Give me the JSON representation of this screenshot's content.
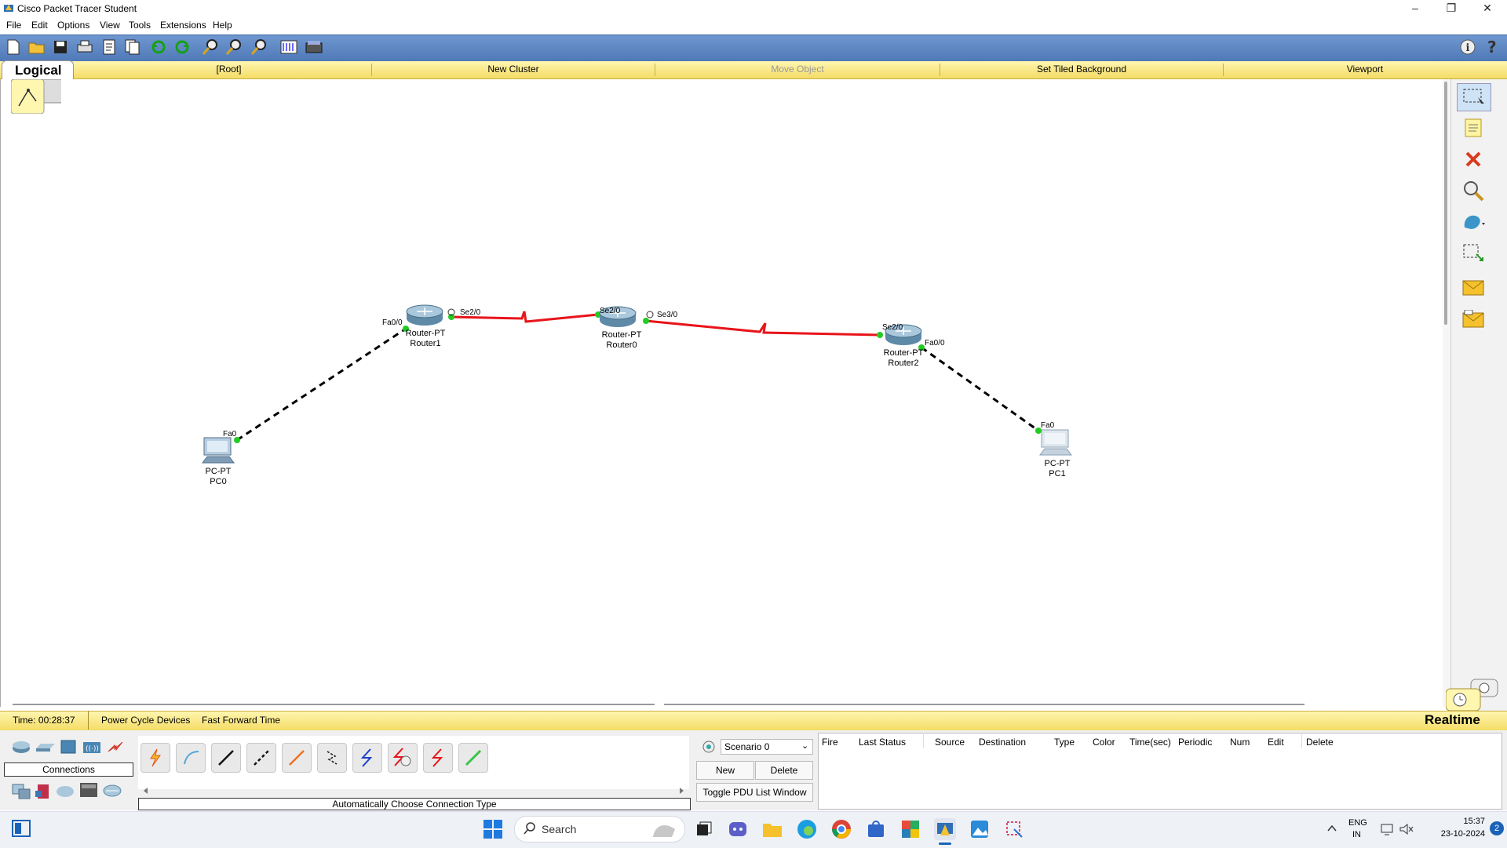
{
  "window": {
    "title": "Cisco Packet Tracer Student",
    "min": "–",
    "max": "❐",
    "close": "✕"
  },
  "menu": [
    "File",
    "Edit",
    "Options",
    "View",
    "Tools",
    "Extensions",
    "Help"
  ],
  "logical_bar": {
    "tab": "Logical",
    "root": "[Root]",
    "new_cluster": "New Cluster",
    "move_object": "Move Object",
    "set_tiled": "Set Tiled Background",
    "viewport": "Viewport"
  },
  "devices": {
    "router1": {
      "type": "Router-PT",
      "name": "Router1"
    },
    "router0": {
      "type": "Router-PT",
      "name": "Router0"
    },
    "router2": {
      "type": "Router-PT",
      "name": "Router2"
    },
    "pc0": {
      "type": "PC-PT",
      "name": "PC0"
    },
    "pc1": {
      "type": "PC-PT",
      "name": "PC1"
    }
  },
  "ports": {
    "r1_fa": "Fa0/0",
    "r1_se": "Se2/0",
    "r0_se2": "Se2/0",
    "r0_se3": "Se3/0",
    "r2_se": "Se2/0",
    "r2_fa": "Fa0/0",
    "pc0_fa": "Fa0",
    "pc1_fa": "Fa0"
  },
  "status": {
    "time": "Time: 00:28:37",
    "power_cycle": "Power Cycle Devices",
    "fast_forward": "Fast Forward Time",
    "mode": "Realtime"
  },
  "bottom": {
    "category": "Connections",
    "conn_type": "Automatically Choose Connection Type",
    "scenario": "Scenario 0",
    "new": "New",
    "delete": "Delete",
    "toggle_pdu": "Toggle PDU List Window"
  },
  "pdu_columns": [
    "Fire",
    "Last Status",
    "Source",
    "Destination",
    "Type",
    "Color",
    "Time(sec)",
    "Periodic",
    "Num",
    "Edit",
    "Delete"
  ],
  "taskbar": {
    "search": "Search",
    "lang1": "ENG",
    "lang2": "IN",
    "time": "15:37",
    "date": "23-10-2024",
    "badge": "2"
  },
  "colors": {
    "serial_link": "#e8141a",
    "ethernet_link": "#000000",
    "port_up": "#22cc22",
    "toolbar": "#5a82be",
    "yellow_bar": "#f4dc66"
  }
}
